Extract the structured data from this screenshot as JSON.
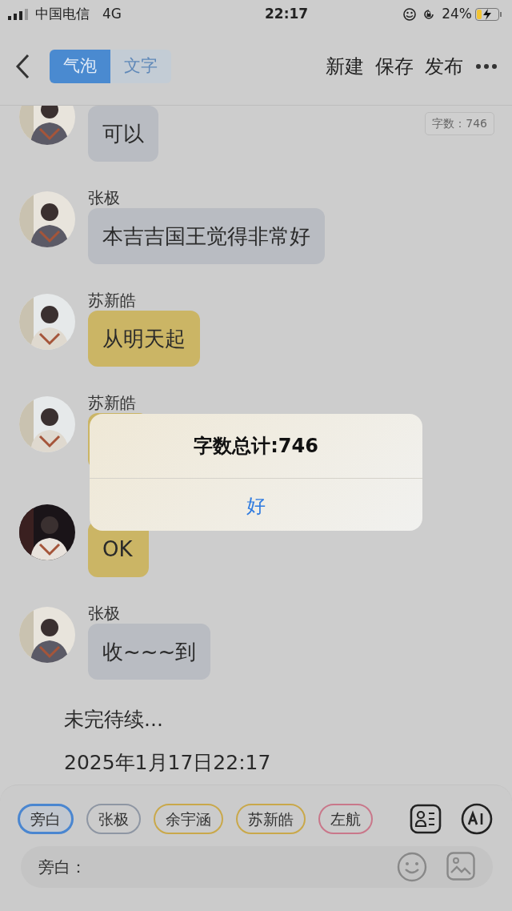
{
  "status_bar": {
    "carrier": "中国电信",
    "network": "4G",
    "time": "22:17",
    "battery_text": "24%"
  },
  "header": {
    "segments": [
      {
        "label": "气泡",
        "selected": true
      },
      {
        "label": "文字",
        "selected": false
      }
    ],
    "actions": [
      "新建",
      "保存",
      "发布"
    ]
  },
  "word_count_badge": "字数：746",
  "messages": [
    {
      "kind": "bubble",
      "text": "可以",
      "color": "#b9bcc2"
    },
    {
      "kind": "bubble",
      "name": "张极",
      "text": "本吉吉国王觉得非常好",
      "color": "#b9bcc2"
    },
    {
      "kind": "bubble",
      "name": "苏新皓",
      "text": "从明天起",
      "color": "#cbb565"
    },
    {
      "kind": "bubble",
      "name": "苏新皓",
      "color": "#cbb565"
    },
    {
      "kind": "bubble",
      "text": "OK",
      "color": "#cbb565"
    },
    {
      "kind": "bubble",
      "name": "张极",
      "text": "收~~~到",
      "color": "#b9bcc2"
    },
    {
      "kind": "narration",
      "text": "未完待续..."
    },
    {
      "kind": "narration",
      "text": "2025年1月17日22:17"
    }
  ],
  "dialog": {
    "title": "字数总计:746",
    "button": "好"
  },
  "characters": [
    {
      "label": "旁白",
      "color": "#4a86d0",
      "selected": true
    },
    {
      "label": "张极",
      "color": "#8e96a3",
      "selected": false
    },
    {
      "label": "余宇涵",
      "color": "#c9a84a",
      "selected": false
    },
    {
      "label": "苏新皓",
      "color": "#c9a84a",
      "selected": false
    },
    {
      "label": "左航",
      "color": "#c9778a",
      "selected": false
    }
  ],
  "input": {
    "placeholder": "旁白："
  }
}
